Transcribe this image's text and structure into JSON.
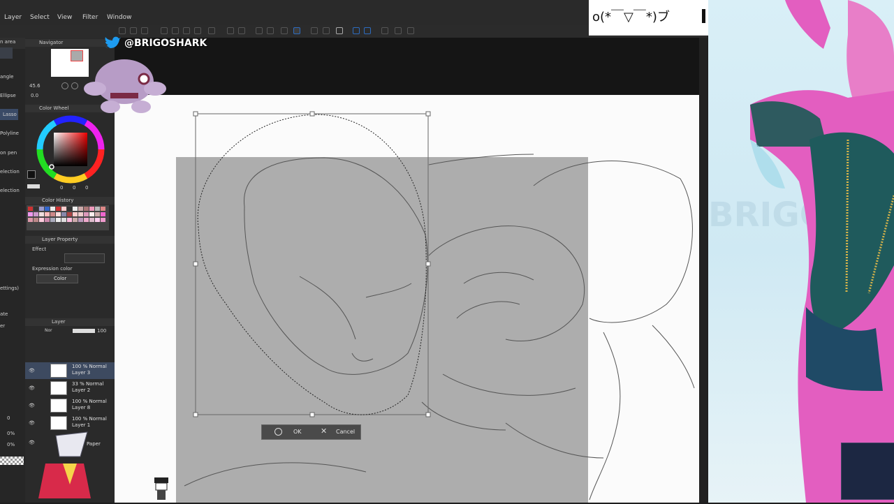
{
  "menu": {
    "items": [
      "Layer",
      "Select",
      "View",
      "Filter",
      "Window"
    ]
  },
  "tools": {
    "labels": [
      "angle",
      "Ellipse",
      "Lasso",
      "Polyline",
      "on pen",
      "election",
      "election"
    ]
  },
  "tools_top_label": "n area",
  "navigator": {
    "title": "Navigator",
    "zoom_value": "45.6",
    "angle_value": "0.0"
  },
  "color_wheel": {
    "title": "Color Wheel",
    "values": [
      "0",
      "0",
      "0"
    ]
  },
  "color_history": {
    "title": "Color History"
  },
  "layer_property": {
    "title": "Layer Property",
    "effect_label": "Effect",
    "expression_label": "Expression color",
    "expression_value": "Color"
  },
  "layer_panel": {
    "title": "Layer",
    "blend_mode": "Nor",
    "opacity": "100",
    "layers": [
      {
        "pct": "100 % Normal",
        "name": "Layer 3"
      },
      {
        "pct": "33 % Normal",
        "name": "Layer 2"
      },
      {
        "pct": "100 % Normal",
        "name": "Layer 8"
      },
      {
        "pct": "100 % Normal",
        "name": "Layer 1"
      },
      {
        "pct": "",
        "name": "Paper"
      }
    ]
  },
  "side_values": [
    "0",
    "0%",
    "0%"
  ],
  "side_labels": [
    "ettings)",
    "ate",
    "er"
  ],
  "transform": {
    "ok_label": "OK",
    "cancel_label": "Cancel"
  },
  "overlay": {
    "twitter_handle": "@BRIGOSHARK",
    "kaomoji": "o(*￣▽￣*)ブ",
    "watermark": "BRIGOSHAR"
  },
  "colors": {
    "accent": "#2d6cc0",
    "gray_area": "#adadad",
    "canvas": "#fbfbfb"
  }
}
